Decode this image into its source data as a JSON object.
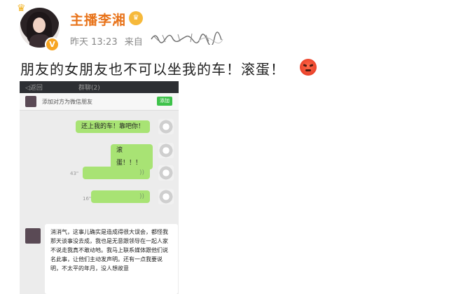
{
  "post": {
    "username": "主播李湘",
    "vip_badge": "vip-crown-icon",
    "time": "昨天 13:23",
    "source_prefix": "来自",
    "text": "朋友的女朋友也不可以坐我的车！滚蛋！"
  },
  "screenshot": {
    "nav_back": "◁返回",
    "nav_title": "群聊(2)",
    "system_message": "添加对方为微信朋友",
    "system_button": "添加",
    "messages": [
      {
        "text": "还上我的车！靠吧你！"
      },
      {
        "text": "滚蛋！！！"
      },
      {
        "text": "",
        "duration": "43\""
      },
      {
        "text": "",
        "duration": "16\""
      }
    ],
    "received_text": "消消气，这事儿确实是造成得很大误会，都怪我那天谈事没去成，我也是无意跟领导在一起人家不说走我真不敢动地。我马上联系媒体跟他们说名此事，让他们主动发声明。还有一点我要说明，不太平的年月，没人想故意"
  }
}
